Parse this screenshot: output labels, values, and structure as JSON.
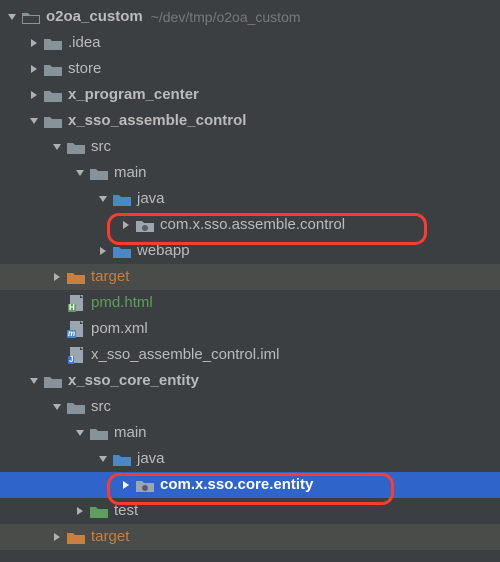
{
  "root": {
    "name": "o2oa_custom",
    "path": "~/dev/tmp/o2oa_custom"
  },
  "nodes": {
    "idea": ".idea",
    "store": "store",
    "xprogram": "x_program_center",
    "xsso_assemble": "x_sso_assemble_control",
    "src1": "src",
    "main1": "main",
    "java1": "java",
    "pkg1": "com.x.sso.assemble.control",
    "webapp": "webapp",
    "target1": "target",
    "pmd": "pmd.html",
    "pom": "pom.xml",
    "iml": "x_sso_assemble_control.iml",
    "xsso_core": "x_sso_core_entity",
    "src2": "src",
    "main2": "main",
    "java2": "java",
    "pkg2": "com.x.sso.core.entity",
    "test": "test",
    "target2": "target"
  },
  "colors": {
    "selection": "#2f65ca",
    "highlight_border": "#ff3b30",
    "orange": "#c97f3d",
    "green": "#5f9e5f"
  }
}
